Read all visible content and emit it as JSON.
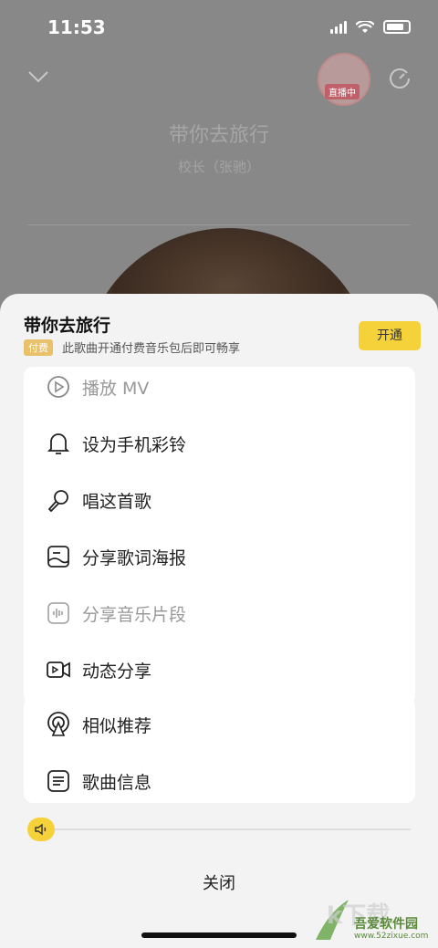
{
  "status_bar": {
    "time": "11:53"
  },
  "player": {
    "title": "带你去旅行",
    "artist": "校长（张驰）",
    "live_badge": "直播中"
  },
  "sheet": {
    "title": "带你去旅行",
    "paid_badge": "付费",
    "paid_desc": "此歌曲开通付费音乐包后即可畅享",
    "open_label": "开通",
    "menu": [
      {
        "label": "播放 MV",
        "icon": "play-icon",
        "disabled": true
      },
      {
        "label": "设为手机彩铃",
        "icon": "bell-icon",
        "disabled": false
      },
      {
        "label": "唱这首歌",
        "icon": "microphone-icon",
        "disabled": false
      },
      {
        "label": "分享歌词海报",
        "icon": "poster-icon",
        "disabled": false
      },
      {
        "label": "分享音乐片段",
        "icon": "audio-wave-icon",
        "disabled": true
      },
      {
        "label": "动态分享",
        "icon": "video-icon",
        "disabled": false
      },
      {
        "label": "相似推荐",
        "icon": "radar-icon",
        "disabled": false
      },
      {
        "label": "歌曲信息",
        "icon": "document-icon",
        "disabled": false
      }
    ],
    "close_label": "关闭",
    "volume_level": 0.0
  },
  "watermark": {
    "title": "吾爱软件园",
    "url": "www.52zixue.com"
  }
}
